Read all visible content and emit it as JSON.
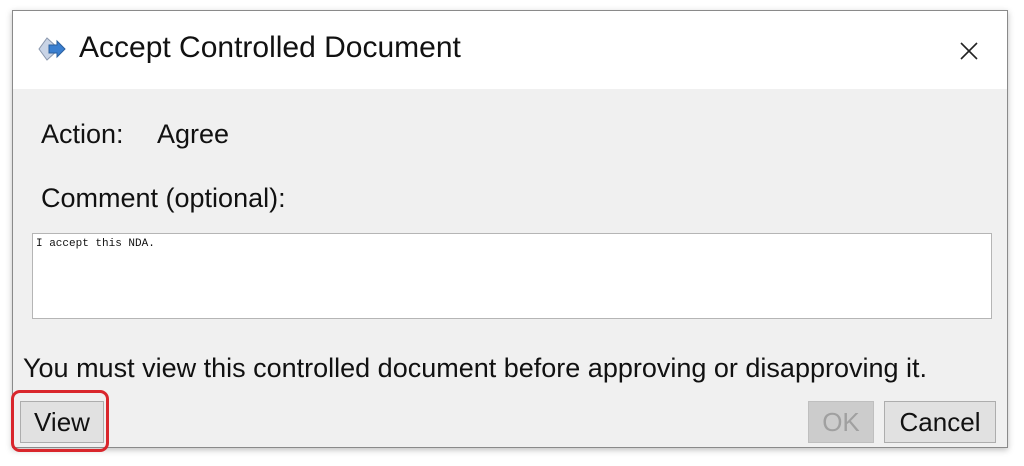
{
  "dialog": {
    "title": "Accept Controlled Document",
    "icon": "document-arrow-icon",
    "close_symbol": "×"
  },
  "form": {
    "action_label": "Action:",
    "action_value": "Agree",
    "comment_label": "Comment (optional):",
    "comment_value": "I accept this NDA."
  },
  "notice": "You must view this controlled document before approving or disapproving it.",
  "buttons": {
    "view": "View",
    "ok": "OK",
    "ok_enabled": false,
    "cancel": "Cancel"
  },
  "annotation": {
    "highlight_target": "view-button",
    "color": "#d9262c"
  }
}
